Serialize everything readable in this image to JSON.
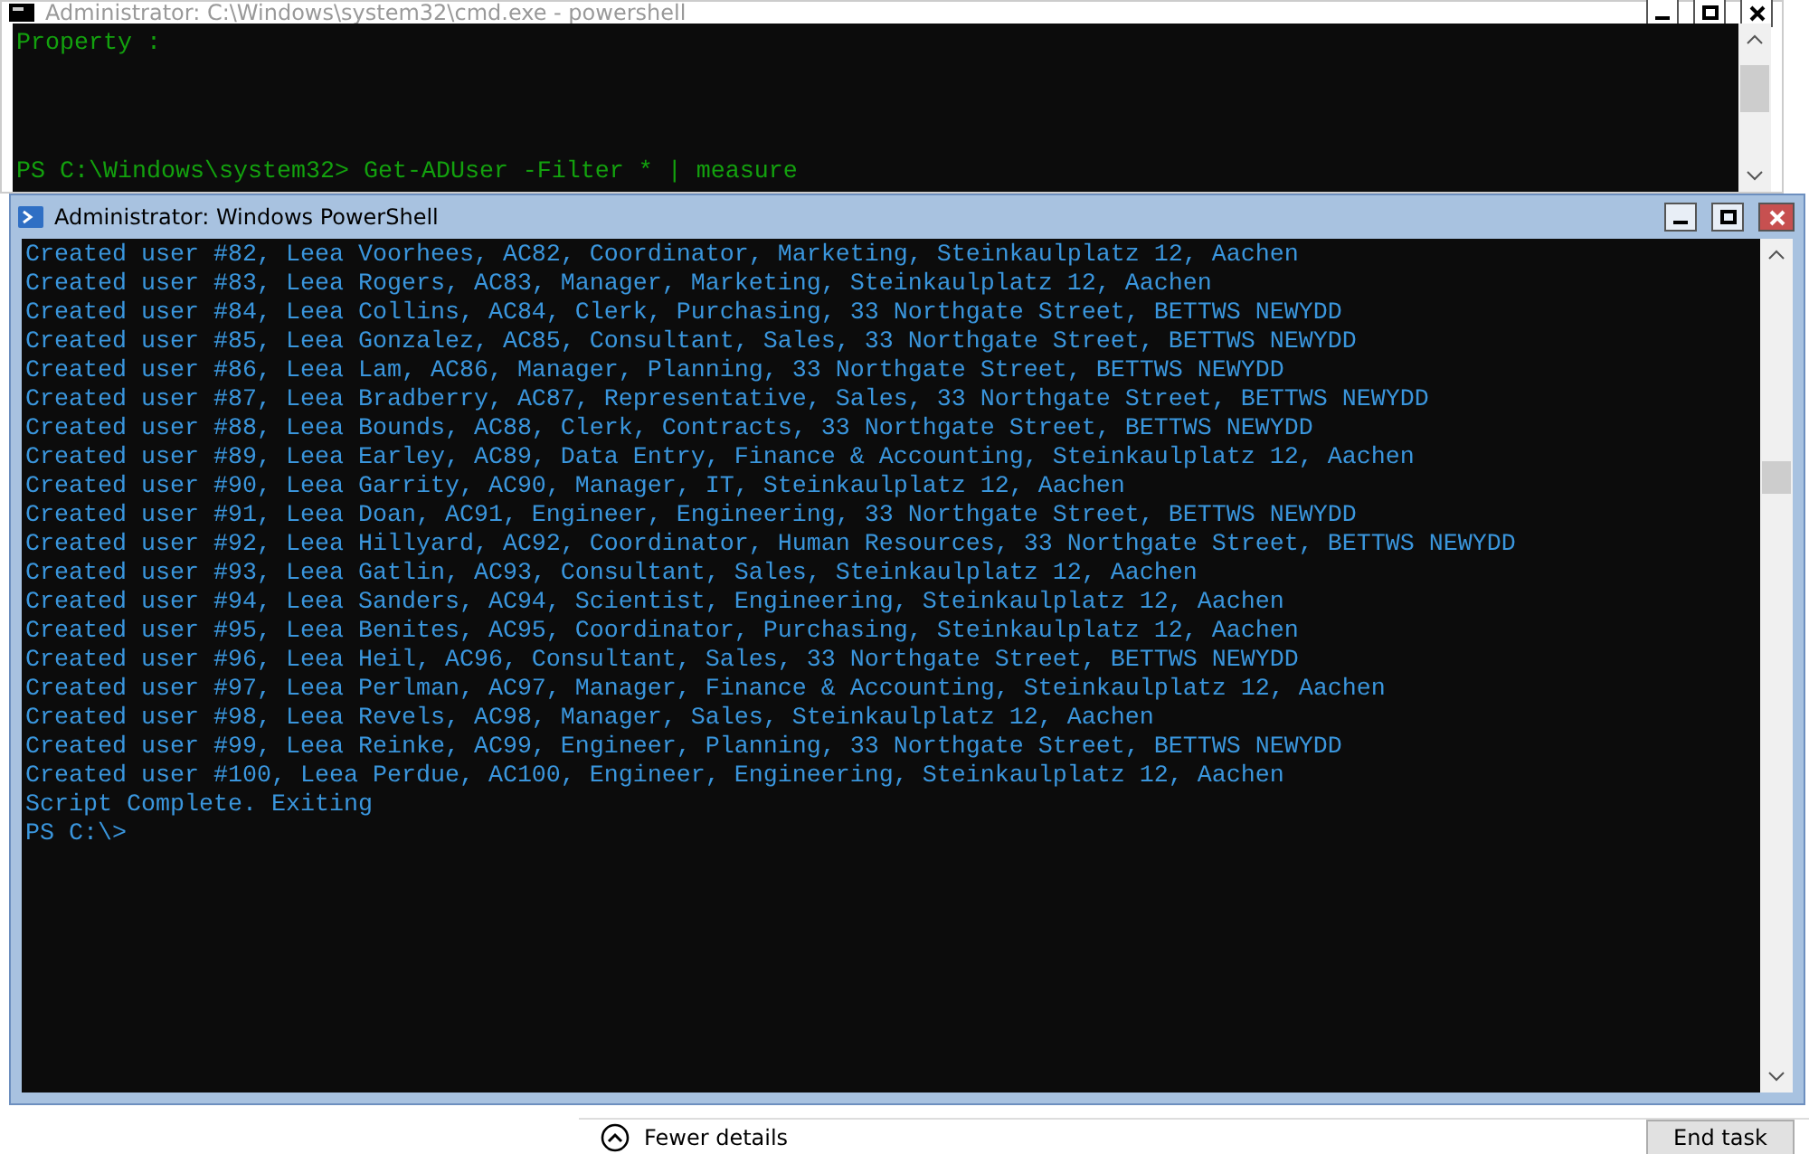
{
  "back_window": {
    "title": "Administrator: C:\\Windows\\system32\\cmd.exe - powershell",
    "lines": [
      "Property :",
      "PS C:\\Windows\\system32> Get-ADUser -Filter * | measure"
    ]
  },
  "front_window": {
    "title": "Administrator: Windows PowerShell",
    "lines": [
      "Created user #82, Leea Voorhees, AC82, Coordinator, Marketing, Steinkaulplatz 12, Aachen",
      "Created user #83, Leea Rogers, AC83, Manager, Marketing, Steinkaulplatz 12, Aachen",
      "Created user #84, Leea Collins, AC84, Clerk, Purchasing, 33 Northgate Street, BETTWS NEWYDD",
      "Created user #85, Leea Gonzalez, AC85, Consultant, Sales, 33 Northgate Street, BETTWS NEWYDD",
      "Created user #86, Leea Lam, AC86, Manager, Planning, 33 Northgate Street, BETTWS NEWYDD",
      "Created user #87, Leea Bradberry, AC87, Representative, Sales, 33 Northgate Street, BETTWS NEWYDD",
      "Created user #88, Leea Bounds, AC88, Clerk, Contracts, 33 Northgate Street, BETTWS NEWYDD",
      "Created user #89, Leea Earley, AC89, Data Entry, Finance & Accounting, Steinkaulplatz 12, Aachen",
      "Created user #90, Leea Garrity, AC90, Manager, IT, Steinkaulplatz 12, Aachen",
      "Created user #91, Leea Doan, AC91, Engineer, Engineering, 33 Northgate Street, BETTWS NEWYDD",
      "Created user #92, Leea Hillyard, AC92, Coordinator, Human Resources, 33 Northgate Street, BETTWS NEWYDD",
      "Created user #93, Leea Gatlin, AC93, Consultant, Sales, Steinkaulplatz 12, Aachen",
      "Created user #94, Leea Sanders, AC94, Scientist, Engineering, Steinkaulplatz 12, Aachen",
      "Created user #95, Leea Benites, AC95, Coordinator, Purchasing, Steinkaulplatz 12, Aachen",
      "Created user #96, Leea Heil, AC96, Consultant, Sales, 33 Northgate Street, BETTWS NEWYDD",
      "Created user #97, Leea Perlman, AC97, Manager, Finance & Accounting, Steinkaulplatz 12, Aachen",
      "Created user #98, Leea Revels, AC98, Manager, Sales, Steinkaulplatz 12, Aachen",
      "Created user #99, Leea Reinke, AC99, Engineer, Planning, 33 Northgate Street, BETTWS NEWYDD",
      "Created user #100, Leea Perdue, AC100, Engineer, Engineering, Steinkaulplatz 12, Aachen",
      "Script Complete. Exiting",
      "PS C:\\>"
    ]
  },
  "task_manager": {
    "details_button": "Fewer details",
    "end_button": "End task"
  }
}
